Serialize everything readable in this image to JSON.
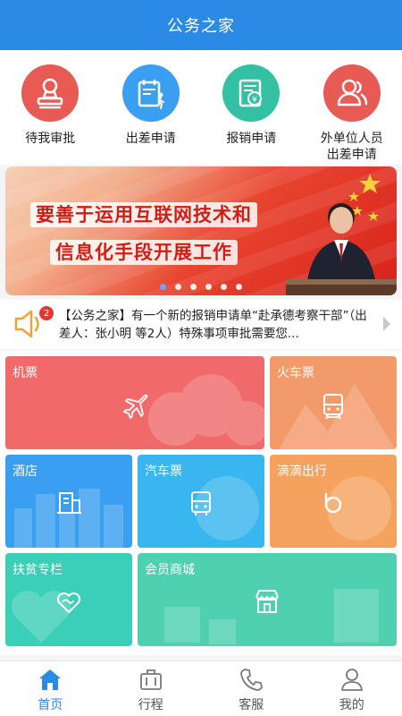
{
  "header": {
    "title": "公务之家"
  },
  "quick_actions": [
    {
      "label": "待我审批",
      "icon": "stamp-icon",
      "color": "#e85a54"
    },
    {
      "label": "出差申请",
      "icon": "travel-calendar-icon",
      "color": "#3a9ff0"
    },
    {
      "label": "报销申请",
      "icon": "reimbursement-document-icon",
      "color": "#34c0a2"
    },
    {
      "label": "外单位人员出差申请",
      "label_line1": "外单位人员",
      "label_line2": "出差申请",
      "icon": "people-icon",
      "color": "#e85a54"
    }
  ],
  "banner": {
    "line1": "要善于运用互联网技术和",
    "line2": "信息化手段开展工作",
    "slides": 6,
    "active_slide": 1
  },
  "notice": {
    "badge": "2",
    "text": "【公务之家】有一个新的报销申请单“赴承德考察干部”（出差人：张小明 等2人）特殊事项审批需要您..."
  },
  "tiles": {
    "flight": {
      "label": "机票",
      "icon": "airplane-icon",
      "color": "#f06a6a"
    },
    "train": {
      "label": "火车票",
      "icon": "train-icon",
      "color": "#f39a6a"
    },
    "hotel": {
      "label": "酒店",
      "icon": "building-icon",
      "color": "#3a9ff0"
    },
    "bus": {
      "label": "汽车票",
      "icon": "bus-icon",
      "color": "#38b6ef"
    },
    "didi": {
      "label": "滴滴出行",
      "icon": "didi-icon",
      "color": "#f5a25e"
    },
    "poverty": {
      "label": "扶贫专栏",
      "icon": "handshake-heart-icon",
      "color": "#3ccfb8"
    },
    "mall": {
      "label": "会员商城",
      "icon": "store-icon",
      "color": "#4fd0b0"
    }
  },
  "tabbar": [
    {
      "label": "首页",
      "icon": "home-icon",
      "active": true
    },
    {
      "label": "行程",
      "icon": "suitcase-icon",
      "active": false
    },
    {
      "label": "客服",
      "icon": "phone-icon",
      "active": false
    },
    {
      "label": "我的",
      "icon": "user-icon",
      "active": false
    }
  ],
  "colors": {
    "primary": "#2b8ae6",
    "tab_inactive": "#666666"
  }
}
